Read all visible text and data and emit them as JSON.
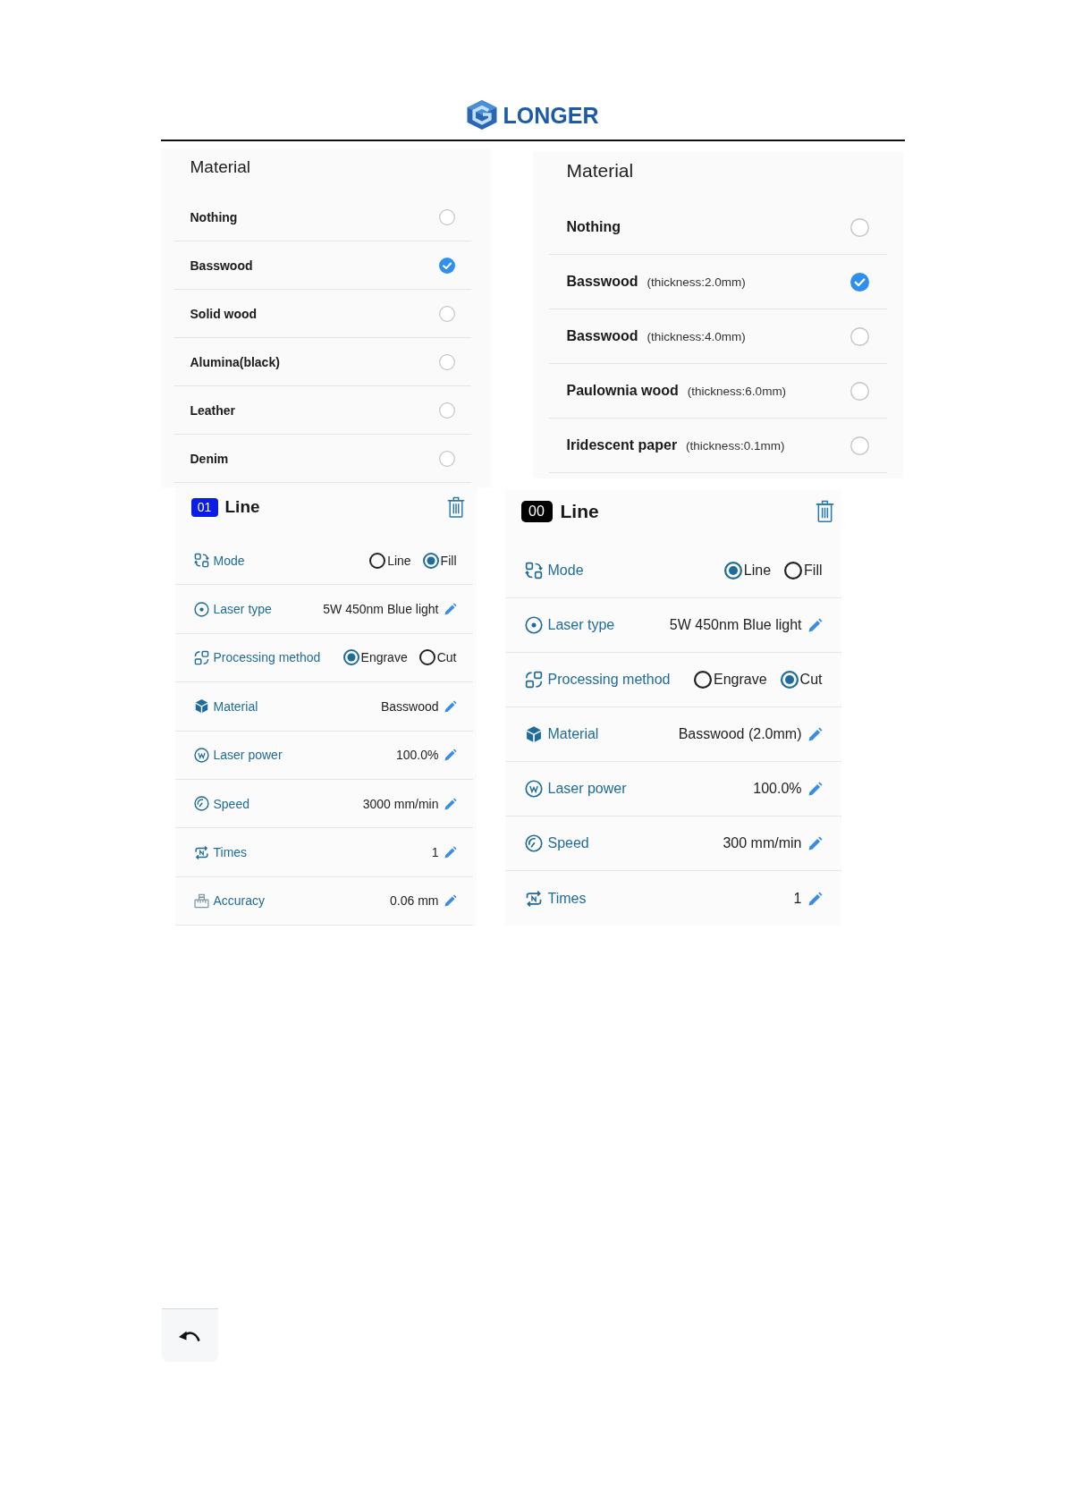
{
  "logo": {
    "text": "LONGER"
  },
  "material_panels": [
    {
      "title": "Material",
      "options": [
        {
          "name": "Nothing",
          "selected": false
        },
        {
          "name": "Basswood",
          "selected": true
        },
        {
          "name": "Solid wood",
          "selected": false
        },
        {
          "name": "Alumina(black)",
          "selected": false
        },
        {
          "name": "Leather",
          "selected": false
        },
        {
          "name": "Denim",
          "selected": false
        }
      ]
    },
    {
      "title": "Material",
      "options": [
        {
          "name": "Nothing",
          "selected": false
        },
        {
          "name": "Basswood",
          "thickness": "(thickness:2.0mm)",
          "selected": true
        },
        {
          "name": "Basswood",
          "thickness": "(thickness:4.0mm)",
          "selected": false
        },
        {
          "name": "Paulownia wood",
          "thickness": "(thickness:6.0mm)",
          "selected": false
        },
        {
          "name": "Iridescent paper",
          "thickness": "(thickness:0.1mm)",
          "selected": false
        }
      ]
    }
  ],
  "layer_panels": [
    {
      "badge": {
        "text": "01",
        "color": "#0a1de6"
      },
      "title": "Line",
      "settings": [
        {
          "kind": "choice",
          "label": "Mode",
          "options": [
            {
              "label": "Line",
              "selected": false
            },
            {
              "label": "Fill",
              "selected": true
            }
          ]
        },
        {
          "kind": "value",
          "label": "Laser type",
          "value": "5W 450nm Blue light"
        },
        {
          "kind": "choice",
          "label": "Processing method",
          "options": [
            {
              "label": "Engrave",
              "selected": true
            },
            {
              "label": "Cut",
              "selected": false
            }
          ]
        },
        {
          "kind": "value",
          "label": "Material",
          "value": "Basswood"
        },
        {
          "kind": "value",
          "label": "Laser power",
          "value": "100.0%"
        },
        {
          "kind": "value",
          "label": "Speed",
          "value": "3000 mm/min"
        },
        {
          "kind": "value",
          "label": "Times",
          "value": "1"
        },
        {
          "kind": "value",
          "label": "Accuracy",
          "value": "0.06 mm"
        }
      ]
    },
    {
      "badge": {
        "text": "00",
        "color": "#000000"
      },
      "title": "Line",
      "settings": [
        {
          "kind": "choice",
          "label": "Mode",
          "options": [
            {
              "label": "Line",
              "selected": true
            },
            {
              "label": "Fill",
              "selected": false
            }
          ]
        },
        {
          "kind": "value",
          "label": "Laser type",
          "value": "5W 450nm Blue light"
        },
        {
          "kind": "choice",
          "label": "Processing method",
          "options": [
            {
              "label": "Engrave",
              "selected": false
            },
            {
              "label": "Cut",
              "selected": true
            }
          ]
        },
        {
          "kind": "value",
          "label": "Material",
          "value": "Basswood (2.0mm)"
        },
        {
          "kind": "value",
          "label": "Laser power",
          "value": "100.0%"
        },
        {
          "kind": "value",
          "label": "Speed",
          "value": "300 mm/min"
        },
        {
          "kind": "value",
          "label": "Times",
          "value": "1"
        }
      ]
    }
  ]
}
